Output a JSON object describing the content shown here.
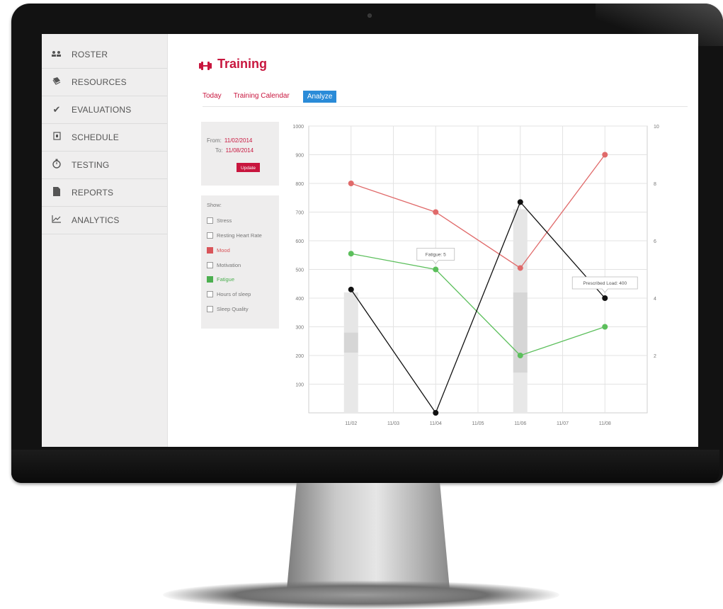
{
  "app": {
    "sidebar": {
      "items": [
        {
          "label": "ROSTER",
          "icon": "roster-icon"
        },
        {
          "label": "RESOURCES",
          "icon": "resources-icon"
        },
        {
          "label": "EVALUATIONS",
          "icon": "checkmark-icon"
        },
        {
          "label": "SCHEDULE",
          "icon": "schedule-icon"
        },
        {
          "label": "TESTING",
          "icon": "stopwatch-icon"
        },
        {
          "label": "REPORTS",
          "icon": "document-icon"
        },
        {
          "label": "ANALYTICS",
          "icon": "line-chart-icon"
        }
      ]
    },
    "header": {
      "title": "Training",
      "title_icon": "dumbbell-icon"
    },
    "tabs": [
      {
        "label": "Today"
      },
      {
        "label": "Training Calendar"
      },
      {
        "label": "Analyze",
        "active": true
      }
    ],
    "date_range": {
      "from_label": "From:",
      "from_value": "11/02/2014",
      "to_label": "To:",
      "to_value": "11/08/2014",
      "update_label": "Update"
    },
    "filters": {
      "show_label": "Show:",
      "items": [
        {
          "label": "Stress",
          "checked": false
        },
        {
          "label": "Resting Heart Rate",
          "checked": false
        },
        {
          "label": "Mood",
          "checked": true,
          "color": "#d9555a"
        },
        {
          "label": "Motivation",
          "checked": false
        },
        {
          "label": "Fatigue",
          "checked": true,
          "color": "#4caf50"
        },
        {
          "label": "Hours of sleep",
          "checked": false
        },
        {
          "label": "Sleep Quality",
          "checked": false
        }
      ]
    },
    "colors": {
      "accent": "#c8163e",
      "active_tab": "#2a8bd8",
      "mood": "#e06a6a",
      "fatigue": "#5cbf5c",
      "load": "#111111"
    }
  },
  "chart_data": {
    "type": "line",
    "x": [
      "11/02",
      "11/03",
      "11/04",
      "11/05",
      "11/06",
      "11/07",
      "11/08"
    ],
    "y_left_ticks": [
      "1000",
      "900",
      "800",
      "700",
      "600",
      "500",
      "400",
      "300",
      "200",
      "100"
    ],
    "y_right_ticks": [
      "10",
      "8",
      "6",
      "4",
      "2"
    ],
    "ylim_left": [
      0,
      1000
    ],
    "ylim_right": [
      0,
      10
    ],
    "grid": true,
    "series": [
      {
        "color": "#e06a6a",
        "axis": "right",
        "points": [
          [
            "11/02",
            8
          ],
          [
            "11/04",
            7
          ],
          [
            "11/06",
            5.05
          ],
          [
            "11/08",
            9
          ]
        ]
      },
      {
        "color": "#5cbf5c",
        "axis": "right",
        "points": [
          [
            "11/02",
            5.55
          ],
          [
            "11/04",
            5
          ],
          [
            "11/06",
            2
          ],
          [
            "11/08",
            3
          ]
        ]
      },
      {
        "color": "#111111",
        "axis": "left",
        "points": [
          [
            "11/02",
            430
          ],
          [
            "11/04",
            0
          ],
          [
            "11/06",
            735
          ],
          [
            "11/08",
            400
          ]
        ]
      }
    ],
    "bars": [
      {
        "x": "11/02",
        "segments": [
          {
            "from": 0,
            "to": 210
          },
          {
            "from": 210,
            "to": 280
          },
          {
            "from": 280,
            "to": 420
          }
        ]
      },
      {
        "x": "11/06",
        "segments": [
          {
            "from": 0,
            "to": 140
          },
          {
            "from": 140,
            "to": 420
          },
          {
            "from": 420,
            "to": 710
          }
        ]
      }
    ],
    "annotations": [
      {
        "text": "Fatigue: 5",
        "x": "11/04",
        "value": 500
      },
      {
        "text": "Prescribed Load: 400",
        "x": "11/08",
        "value": 400
      }
    ]
  }
}
